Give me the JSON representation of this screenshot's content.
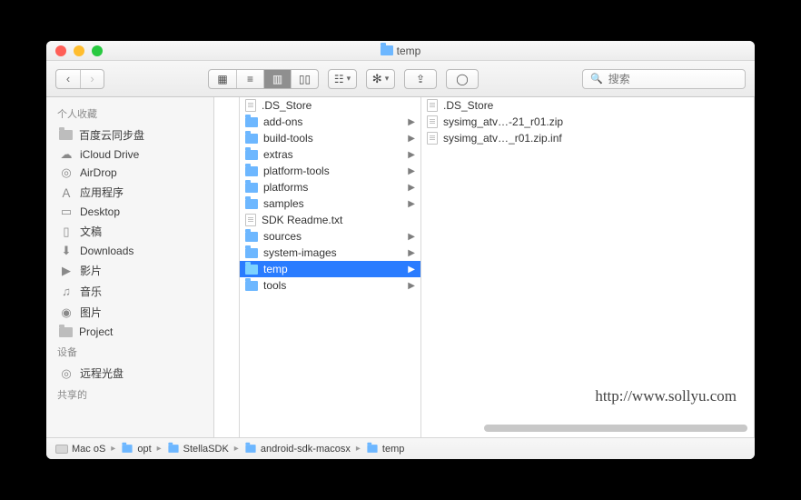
{
  "window_title": "temp",
  "titlebar_icon": "folder-icon",
  "toolbar": {
    "back_disabled": false,
    "forward_disabled": true
  },
  "search": {
    "placeholder": "搜索"
  },
  "sidebar": {
    "sections": [
      {
        "header": "个人收藏",
        "items": [
          {
            "icon": "folder",
            "label": "百度云同步盘"
          },
          {
            "icon": "cloud",
            "label": "iCloud Drive"
          },
          {
            "icon": "airdrop",
            "label": "AirDrop"
          },
          {
            "icon": "app",
            "label": "应用程序"
          },
          {
            "icon": "desktop",
            "label": "Desktop"
          },
          {
            "icon": "doc",
            "label": "文稿"
          },
          {
            "icon": "download",
            "label": "Downloads"
          },
          {
            "icon": "movie",
            "label": "影片"
          },
          {
            "icon": "music",
            "label": "音乐"
          },
          {
            "icon": "photo",
            "label": "图片"
          },
          {
            "icon": "folder",
            "label": "Project"
          }
        ]
      },
      {
        "header": "设备",
        "items": [
          {
            "icon": "disc",
            "label": "远程光盘"
          }
        ]
      },
      {
        "header": "共享的",
        "items": []
      }
    ]
  },
  "columns": [
    [
      {
        "type": "file",
        "name": ".DS_Store"
      },
      {
        "type": "folder",
        "name": "add-ons"
      },
      {
        "type": "folder",
        "name": "build-tools"
      },
      {
        "type": "folder",
        "name": "extras"
      },
      {
        "type": "folder",
        "name": "platform-tools"
      },
      {
        "type": "folder",
        "name": "platforms"
      },
      {
        "type": "folder",
        "name": "samples"
      },
      {
        "type": "file",
        "name": "SDK Readme.txt"
      },
      {
        "type": "folder",
        "name": "sources"
      },
      {
        "type": "folder",
        "name": "system-images"
      },
      {
        "type": "folder",
        "name": "temp",
        "selected": true
      },
      {
        "type": "folder",
        "name": "tools"
      }
    ],
    [
      {
        "type": "file",
        "name": ".DS_Store"
      },
      {
        "type": "file",
        "name": "sysimg_atv…-21_r01.zip"
      },
      {
        "type": "file",
        "name": "sysimg_atv…_r01.zip.inf"
      }
    ]
  ],
  "pathbar": [
    {
      "icon": "drive",
      "label": "Mac oS"
    },
    {
      "icon": "folder",
      "label": "opt"
    },
    {
      "icon": "folder",
      "label": "StellaSDK"
    },
    {
      "icon": "folder",
      "label": "android-sdk-macosx"
    },
    {
      "icon": "folder",
      "label": "temp"
    }
  ],
  "watermark": "http://www.sollyu.com"
}
